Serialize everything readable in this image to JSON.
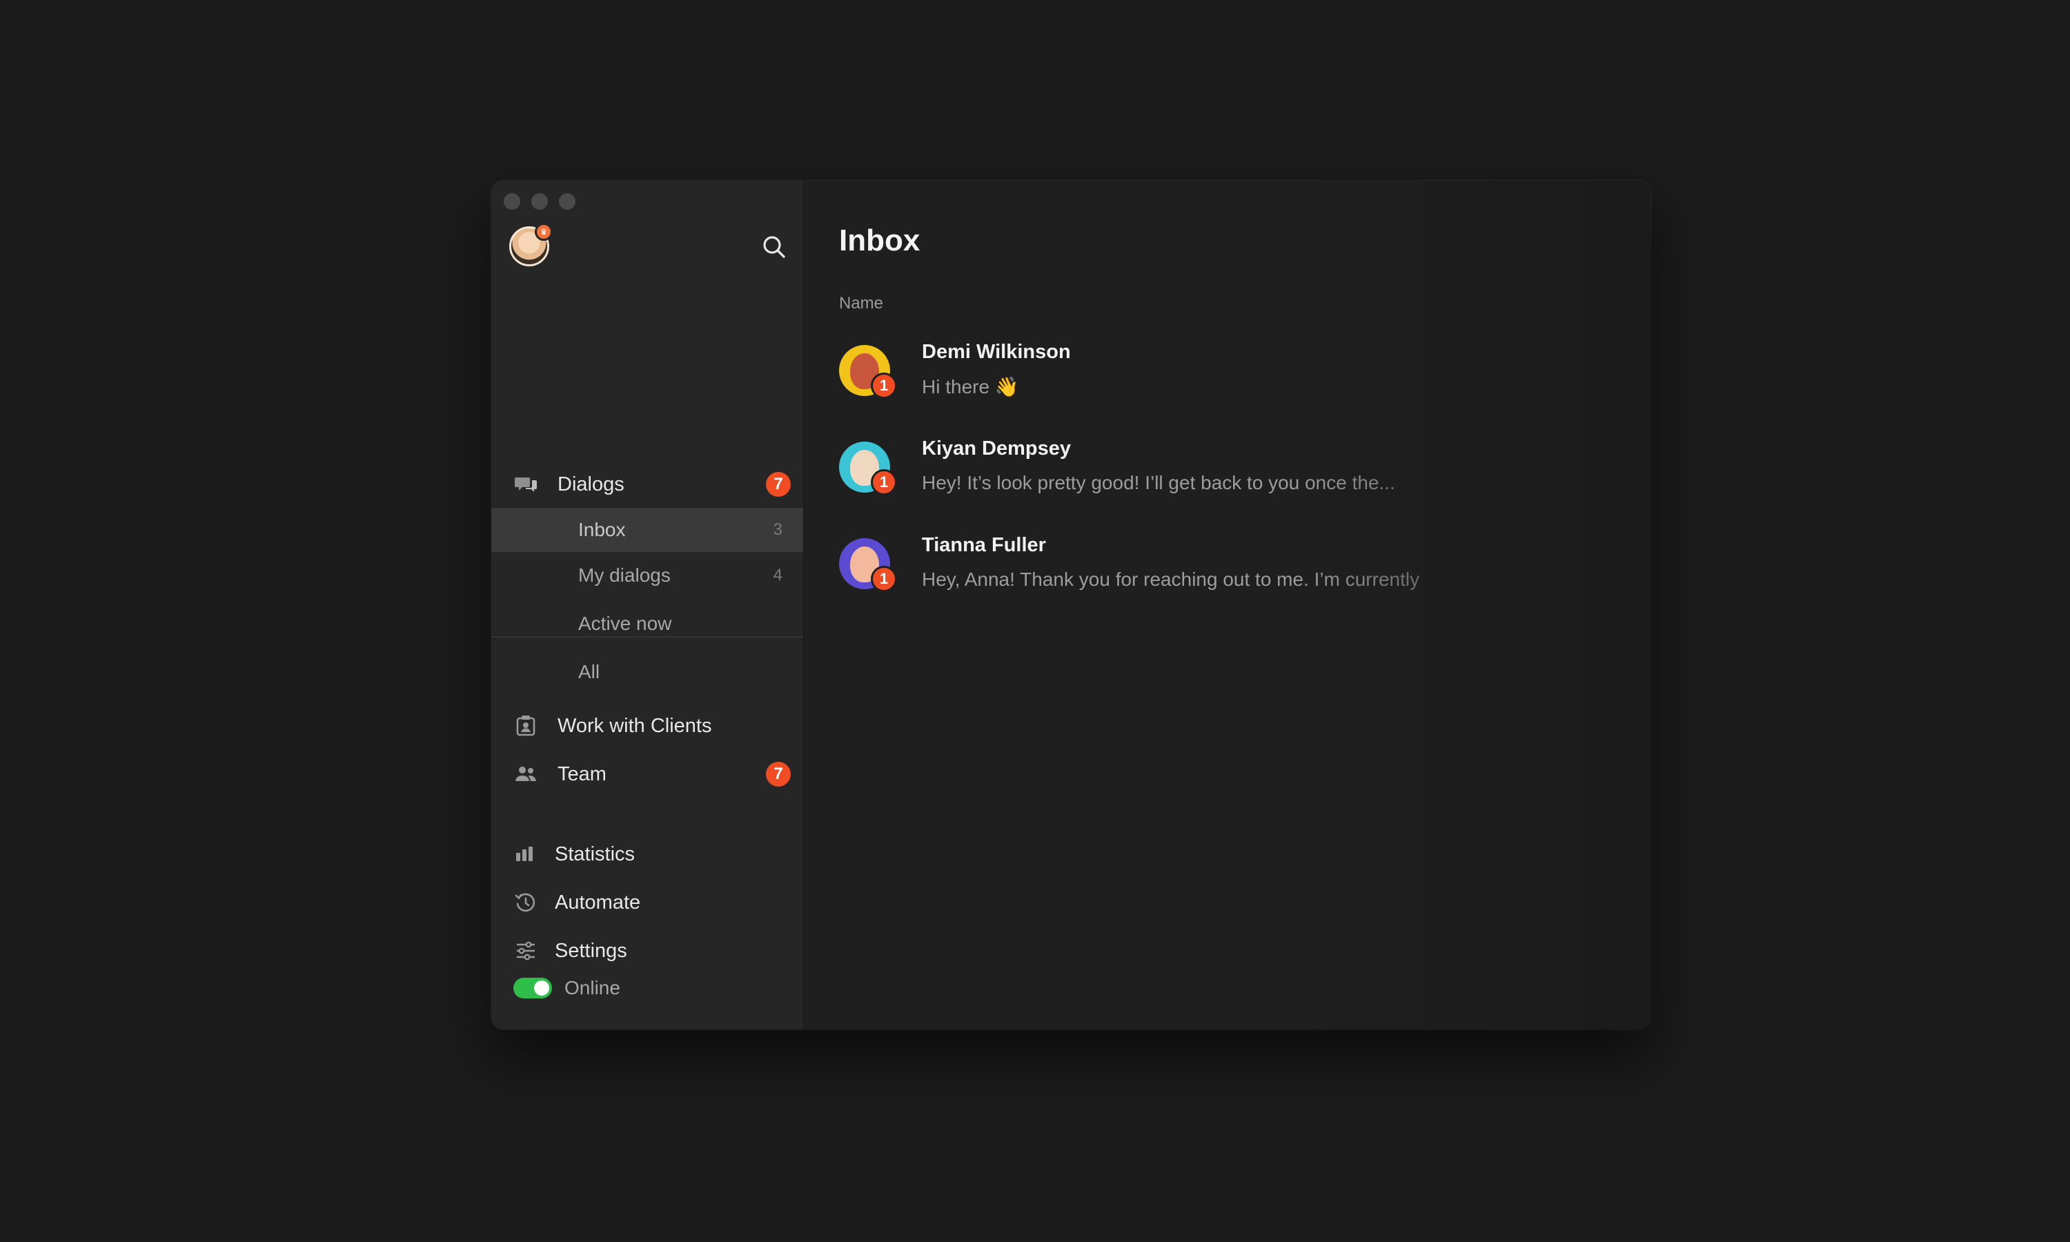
{
  "sidebar": {
    "nav": {
      "dialogs": {
        "label": "Dialogs",
        "badge": "7"
      },
      "work_with_clients": {
        "label": "Work with Clients"
      },
      "team": {
        "label": "Team",
        "badge": "7"
      }
    },
    "dialogs_sub": [
      {
        "label": "Inbox",
        "count": "3",
        "active": true
      },
      {
        "label": "My dialogs",
        "count": "4"
      },
      {
        "label": "Active now",
        "count": ""
      },
      {
        "label": "All",
        "count": ""
      }
    ],
    "secondary": [
      {
        "label": "Statistics",
        "icon": "bar-chart-icon"
      },
      {
        "label": "Automate",
        "icon": "clock-refresh-icon"
      },
      {
        "label": "Settings",
        "icon": "sliders-icon"
      }
    ],
    "status": {
      "label": "Online",
      "online": true
    }
  },
  "main": {
    "title": "Inbox",
    "column_header": "Name",
    "conversations": [
      {
        "name": "Demi Wilkinson",
        "preview": "Hi there 👋",
        "unread": "1",
        "avatar_color": "#f2c318"
      },
      {
        "name": "Kiyan Dempsey",
        "preview": "Hey! It’s look pretty good! I’ll get back to you once the...",
        "unread": "1",
        "avatar_color": "#3bc3d6"
      },
      {
        "name": "Tianna Fuller",
        "preview": "Hey, Anna! Thank you for reaching out to me. I’m currently",
        "unread": "1",
        "avatar_color": "#5a4bd1"
      }
    ]
  },
  "colors": {
    "accent_badge": "#f04d25",
    "online_toggle": "#2fbe4a",
    "sidebar_bg": "#262626",
    "main_bg": "#1f1f1f"
  }
}
